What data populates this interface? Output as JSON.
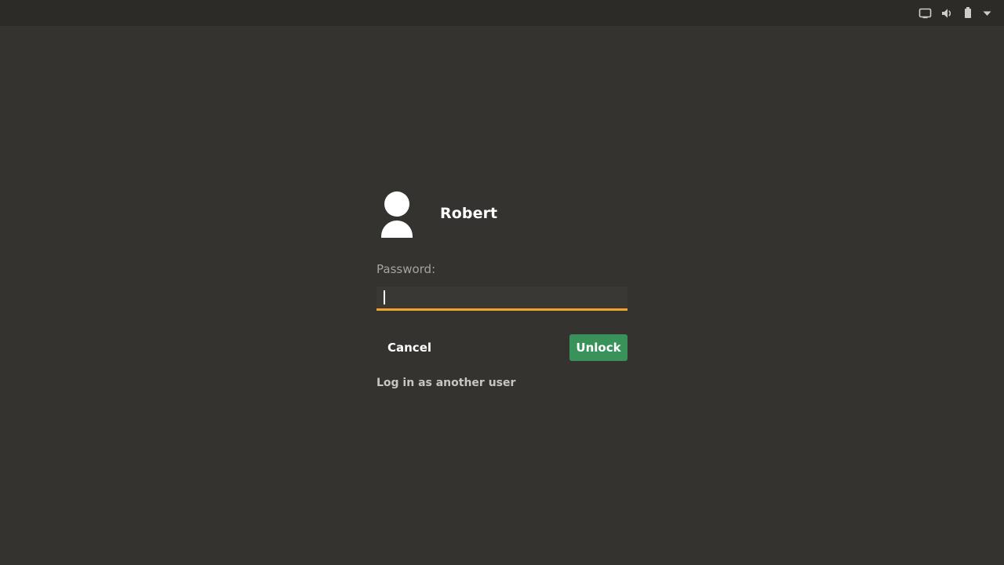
{
  "screen": {
    "background_color": "#353330",
    "topbar_color": "#2d2b27"
  },
  "topbar": {
    "tray_items": [
      {
        "name": "display-icon",
        "label": "Display"
      },
      {
        "name": "volume-icon",
        "label": "Volume"
      },
      {
        "name": "battery-icon",
        "label": "Battery"
      },
      {
        "name": "system-menu-chevron-icon",
        "label": "System menu"
      }
    ]
  },
  "unlock": {
    "avatar_name": "user-avatar",
    "username": "Robert",
    "password_label": "Password:",
    "password_value": "",
    "password_placeholder": "",
    "cancel_label": "Cancel",
    "unlock_label": "Unlock",
    "other_user_label": "Log in as another user",
    "accent_color": "#f0a42a",
    "unlock_button_color": "#38925a"
  }
}
